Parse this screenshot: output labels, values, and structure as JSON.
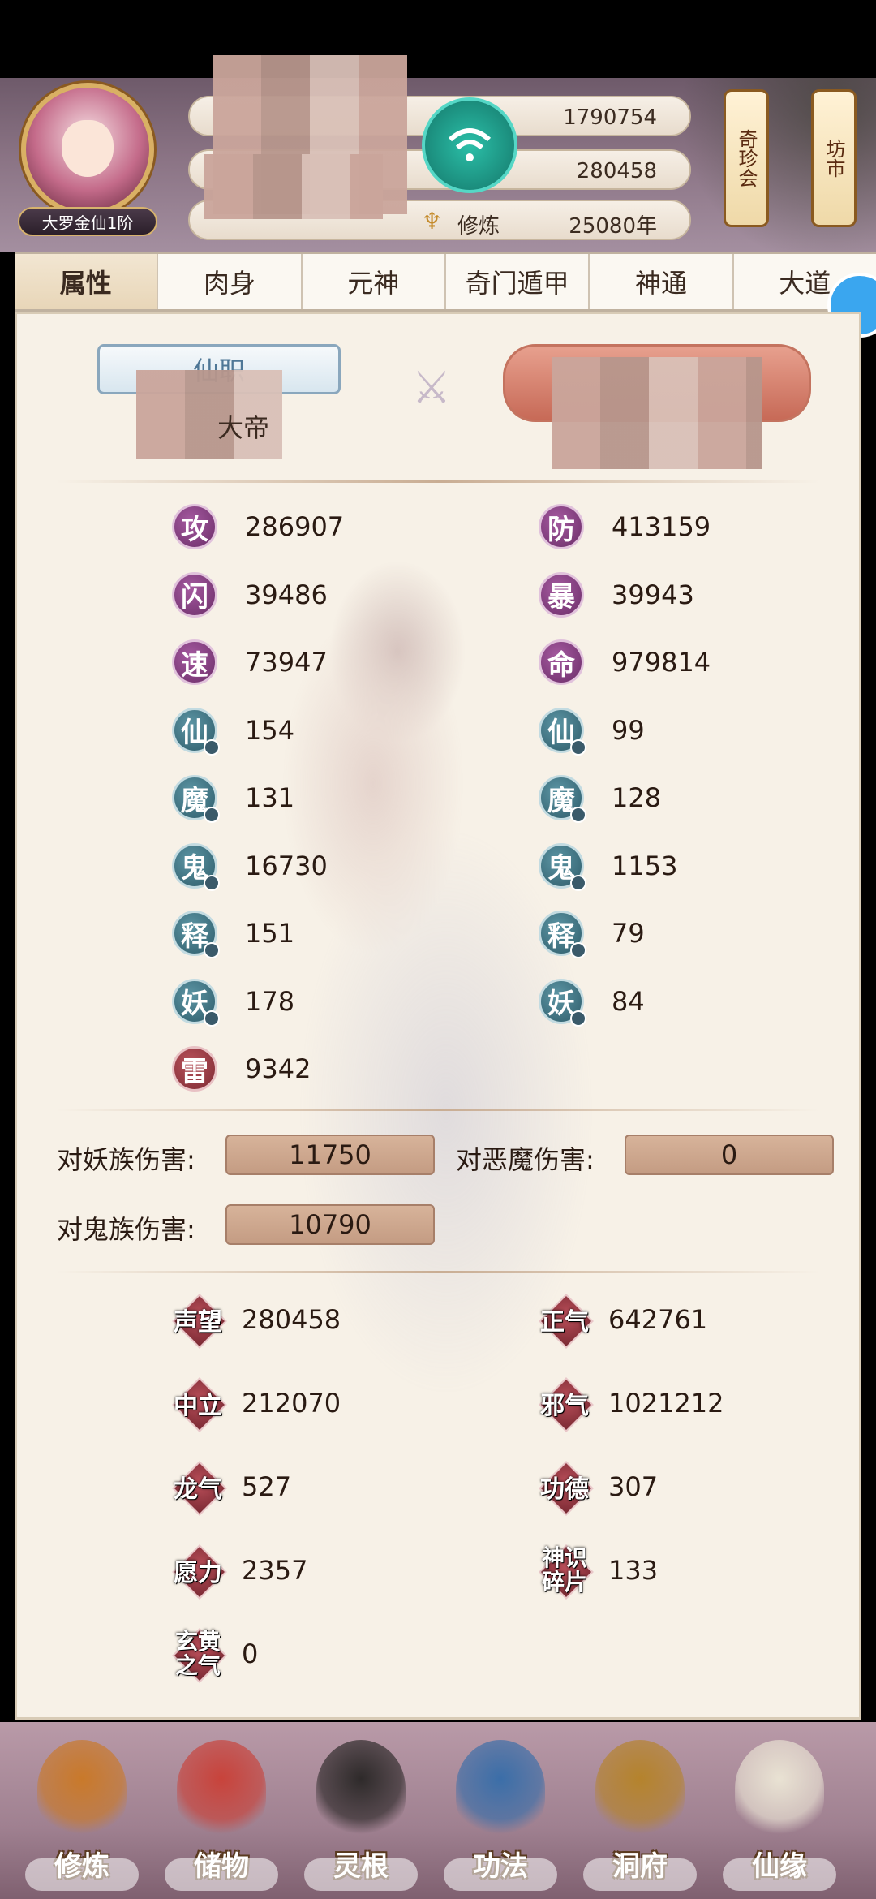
{
  "header": {
    "rank": "大罗金仙1阶",
    "rows": [
      {
        "label": "",
        "value": "1790754"
      },
      {
        "label": "",
        "value": "280458"
      },
      {
        "label": "修炼",
        "value": "25080年"
      }
    ],
    "scrolls": [
      {
        "label": "奇珍会"
      },
      {
        "label": "坊市"
      }
    ]
  },
  "tabs": [
    "属性",
    "肉身",
    "元神",
    "奇门遁甲",
    "神通",
    "大道"
  ],
  "position": {
    "left_label": "仙职",
    "left_value": "大帝"
  },
  "stats": [
    {
      "char": "攻",
      "value": "286907",
      "style": "purple"
    },
    {
      "char": "防",
      "value": "413159",
      "style": "purple"
    },
    {
      "char": "闪",
      "value": "39486",
      "style": "purple"
    },
    {
      "char": "暴",
      "value": "39943",
      "style": "purple"
    },
    {
      "char": "速",
      "value": "73947",
      "style": "purple"
    },
    {
      "char": "命",
      "value": "979814",
      "style": "purple"
    },
    {
      "char": "仙",
      "value": "154",
      "style": "teal"
    },
    {
      "char": "仙",
      "value": "99",
      "style": "teal"
    },
    {
      "char": "魔",
      "value": "131",
      "style": "teal"
    },
    {
      "char": "魔",
      "value": "128",
      "style": "teal"
    },
    {
      "char": "鬼",
      "value": "16730",
      "style": "teal"
    },
    {
      "char": "鬼",
      "value": "1153",
      "style": "teal"
    },
    {
      "char": "释",
      "value": "151",
      "style": "teal"
    },
    {
      "char": "释",
      "value": "79",
      "style": "teal"
    },
    {
      "char": "妖",
      "value": "178",
      "style": "teal"
    },
    {
      "char": "妖",
      "value": "84",
      "style": "teal"
    },
    {
      "char": "雷",
      "value": "9342",
      "style": "red"
    }
  ],
  "damage": [
    {
      "label": "对妖族伤害:",
      "value": "11750"
    },
    {
      "label": "对恶魔伤害:",
      "value": "0"
    },
    {
      "label": "对鬼族伤害:",
      "value": "10790"
    }
  ],
  "reputation": [
    {
      "label": "声望",
      "value": "280458"
    },
    {
      "label": "正气",
      "value": "642761"
    },
    {
      "label": "中立",
      "value": "212070"
    },
    {
      "label": "邪气",
      "value": "1021212"
    },
    {
      "label": "龙气",
      "value": "527"
    },
    {
      "label": "功德",
      "value": "307"
    },
    {
      "label": "愿力",
      "value": "2357"
    },
    {
      "label": "神识碎片",
      "value": "133"
    },
    {
      "label": "玄黄之气",
      "value": "0"
    }
  ],
  "nav": [
    {
      "label": "修炼",
      "icon": "meditating-monk-icon"
    },
    {
      "label": "储物",
      "icon": "storage-bag-icon"
    },
    {
      "label": "灵根",
      "icon": "spirit-root-icon"
    },
    {
      "label": "功法",
      "icon": "technique-book-icon"
    },
    {
      "label": "洞府",
      "icon": "cave-mansion-icon"
    },
    {
      "label": "仙缘",
      "icon": "gourd-icon"
    }
  ],
  "colors": {
    "accent": "#d9b064",
    "panel": "#f7f1e7",
    "stat_purple": "#6b2d68",
    "stat_teal": "#2e5c6a"
  }
}
